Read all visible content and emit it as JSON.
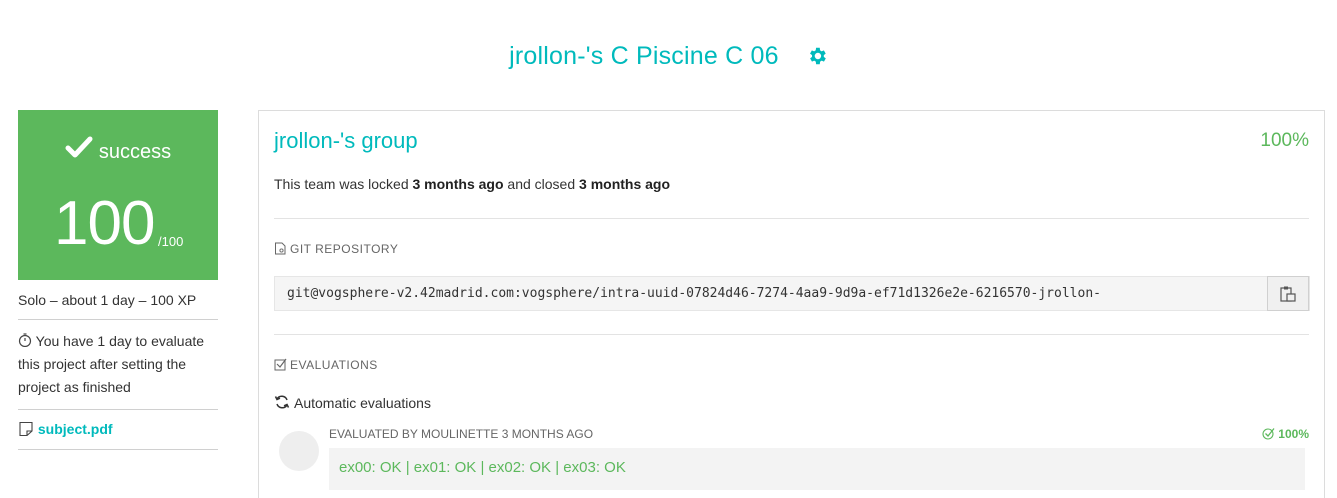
{
  "header": {
    "title": "jrollon-'s C Piscine C 06",
    "settings_icon": "gear-icon"
  },
  "status": {
    "label": "success",
    "score": "100",
    "max": "/100",
    "color": "#5cb85c"
  },
  "sidebar": {
    "meta": "Solo – about 1 day – 100 XP",
    "timer_note": "You have 1 day to evaluate this project after setting the project as finished",
    "subject_link": "subject.pdf"
  },
  "group": {
    "title": "jrollon-'s group",
    "percent": "100%",
    "lock_prefix": "This team was locked ",
    "locked_ago": "3 months ago",
    "lock_mid": " and closed ",
    "closed_ago": "3 months ago"
  },
  "git": {
    "section_label": "GIT REPOSITORY",
    "url": "git@vogsphere-v2.42madrid.com:vogsphere/intra-uuid-07824d46-7274-4aa9-9d9a-ef71d1326e2e-6216570-jrollon-"
  },
  "evaluations": {
    "section_label": "EVALUATIONS",
    "auto_label": "Automatic evaluations",
    "items": [
      {
        "evaluator": "EVALUATED BY MOULINETTE 3 MONTHS AGO",
        "score": "100%",
        "result": "ex00: OK | ex01: OK | ex02: OK | ex03: OK"
      }
    ]
  },
  "colors": {
    "accent": "#00babc",
    "success": "#5cb85c"
  }
}
